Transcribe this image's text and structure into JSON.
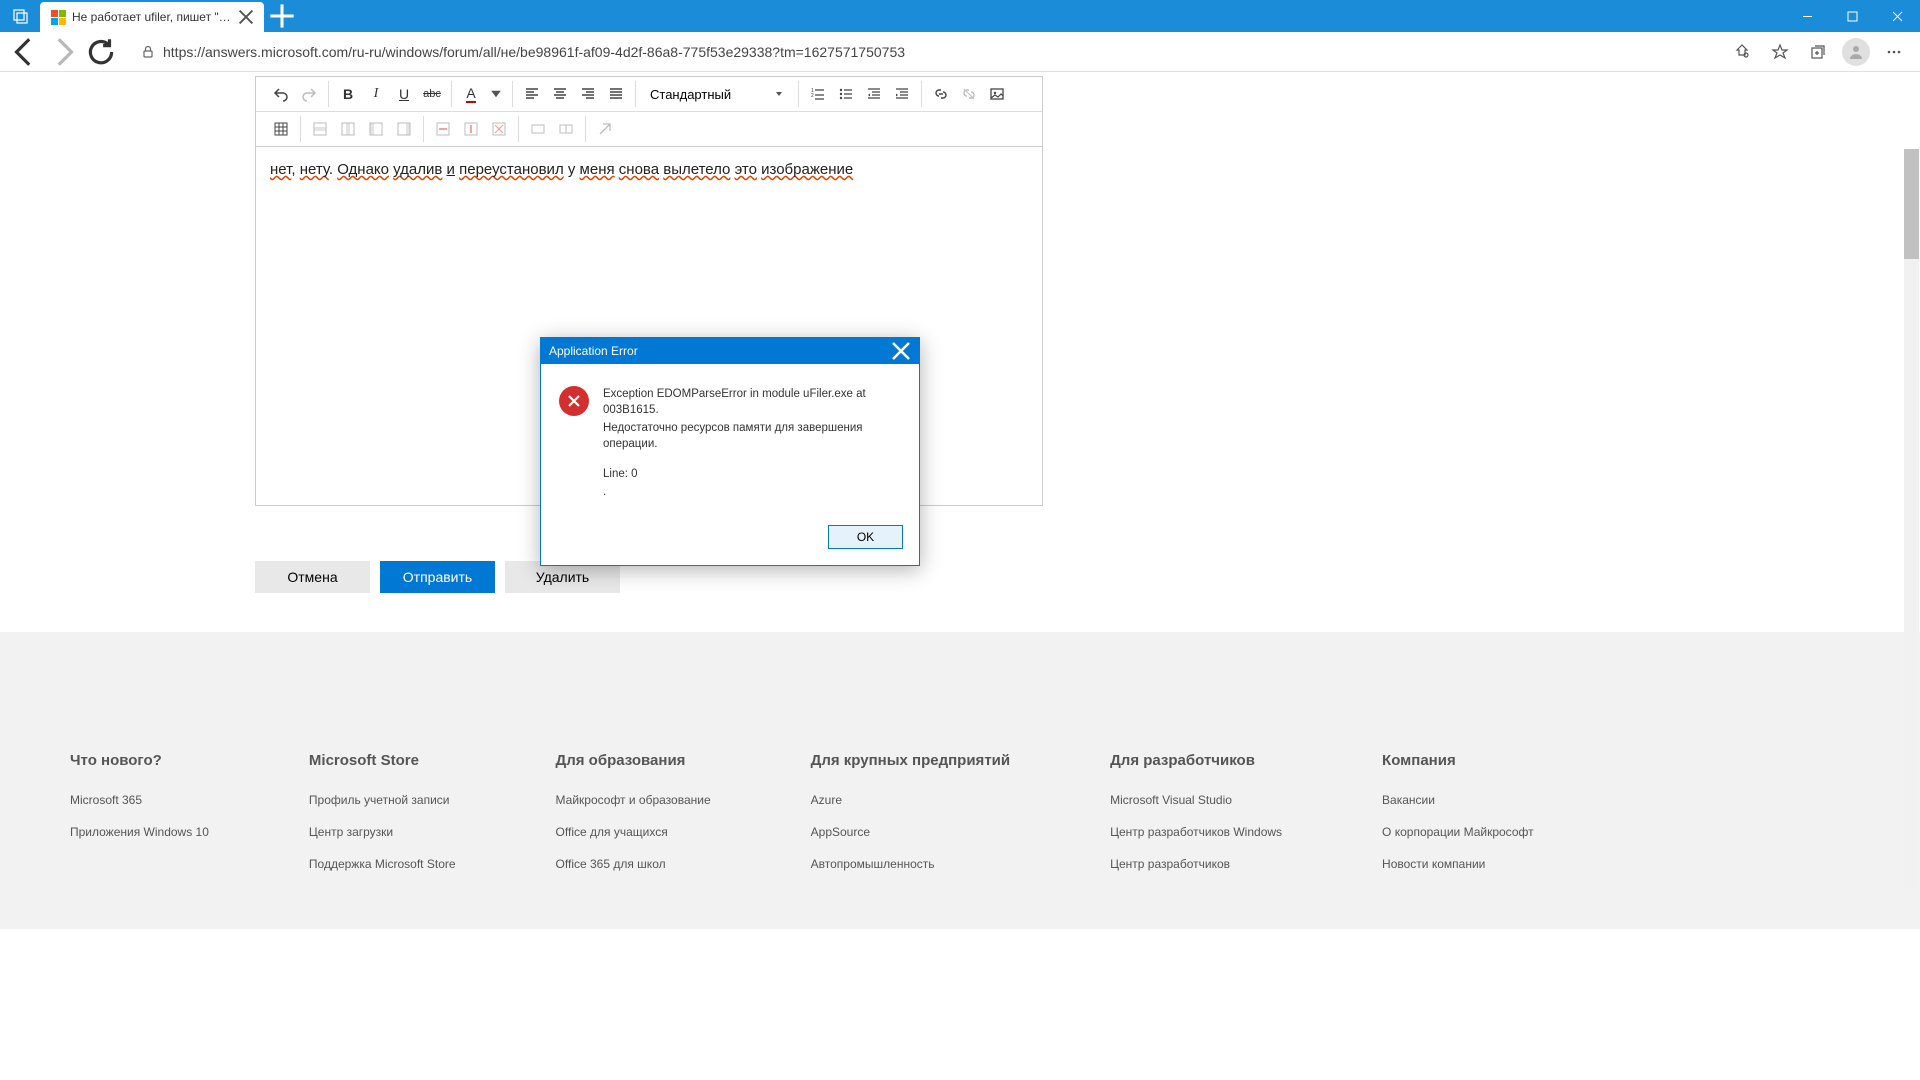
{
  "browser": {
    "tab_title": "Не работает ufiler, пишет \"exce...",
    "url": "https://answers.microsoft.com/ru-ru/windows/forum/all/не/be98961f-af09-4d2f-86a8-775f53e29338?tm=1627571750753"
  },
  "editor": {
    "style_select": "Стандартный",
    "content_words": [
      "нет",
      ", ",
      "нету",
      ". ",
      "Однако",
      " ",
      "удалив",
      " ",
      "и",
      " ",
      "переустановил",
      " у ",
      "меня",
      " ",
      "снова",
      " ",
      "вылетело",
      " ",
      "это",
      " ",
      "изображение"
    ]
  },
  "buttons": {
    "cancel": "Отмена",
    "send": "Отправить",
    "delete": "Удалить"
  },
  "dialog": {
    "title": "Application Error",
    "line1": "Exception EDOMParseError in module uFiler.exe at 003B1615.",
    "line2": "Недостаточно ресурсов памяти для завершения операции.",
    "line3": "Line: 0",
    "line4": ".",
    "ok": "OK"
  },
  "footer": {
    "cols": [
      {
        "h": "Что нового?",
        "items": [
          "Microsoft 365",
          "Приложения Windows 10"
        ]
      },
      {
        "h": "Microsoft Store",
        "items": [
          "Профиль учетной записи",
          "Центр загрузки",
          "Поддержка Microsoft Store"
        ]
      },
      {
        "h": "Для образования",
        "items": [
          "Майкрософт и образование",
          "Office для учащихся",
          "Office 365 для школ"
        ]
      },
      {
        "h": "Для крупных предприятий",
        "items": [
          "Azure",
          "AppSource",
          "Автопромышленность"
        ]
      },
      {
        "h": "Для разработчиков",
        "items": [
          "Microsoft Visual Studio",
          "Центр разработчиков Windows",
          "Центр разработчиков"
        ]
      },
      {
        "h": "Компания",
        "items": [
          "Вакансии",
          "О корпорации Майкрософт",
          "Новости компании"
        ]
      }
    ]
  }
}
